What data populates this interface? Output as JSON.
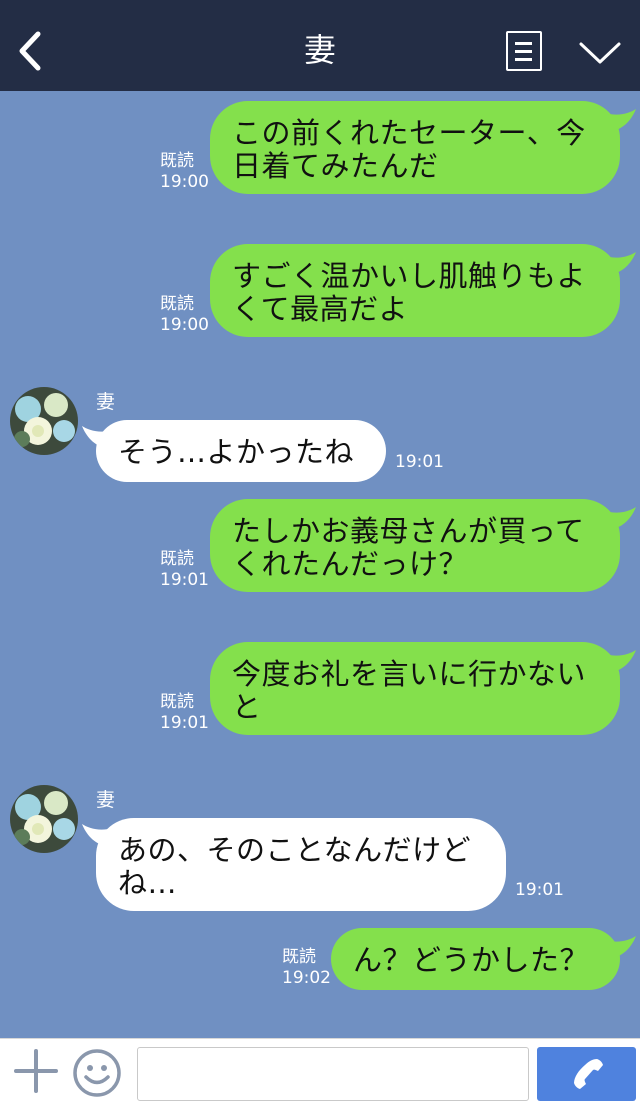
{
  "header": {
    "title": "妻"
  },
  "messages": [
    {
      "text": "この前くれたセーター、今日着てみたんだ",
      "read": "既読",
      "time": "19:00"
    },
    {
      "text": "すごく温かいし肌触りもよくて最高だよ",
      "read": "既読",
      "time": "19:00"
    },
    {
      "sender": "妻",
      "text": "そう…よかったね",
      "time": "19:01"
    },
    {
      "text": "たしかお義母さんが買ってくれたんだっけ？",
      "read": "既読",
      "time": "19:01"
    },
    {
      "text": "今度お礼を言いに行かないと",
      "read": "既読",
      "time": "19:01"
    },
    {
      "sender": "妻",
      "text": "あの、そのことなんだけどね…",
      "time": "19:01"
    },
    {
      "text": "ん？どうかした？",
      "read": "既読",
      "time": "19:02"
    }
  ],
  "colors": {
    "header_bg": "#232d45",
    "chat_bg": "#7090c2",
    "my_bubble": "#84e04c",
    "their_bubble": "#ffffff",
    "call_button": "#4f82de"
  },
  "icons": [
    "back-chevron-icon",
    "menu-list-icon",
    "chevron-down-icon",
    "plus-icon",
    "smiley-icon",
    "phone-icon"
  ]
}
